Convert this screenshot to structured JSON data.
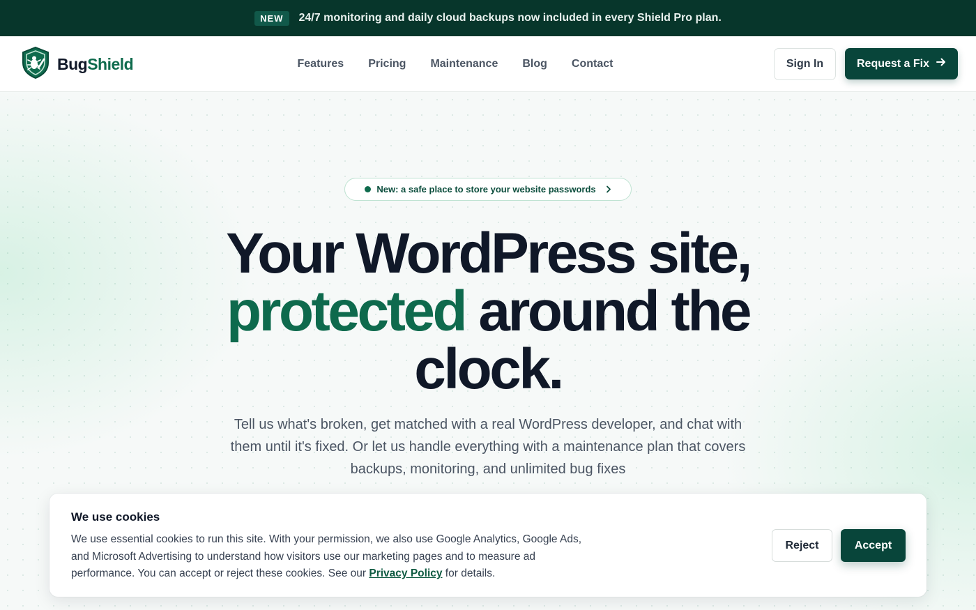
{
  "announcement": {
    "badge": "NEW",
    "message": "24/7 monitoring and daily cloud backups now included in every Shield Pro plan."
  },
  "brand": {
    "name_part1": "Bug",
    "name_part2": "Shield",
    "icon": "shield-bug-icon",
    "colors": {
      "primary": "#08453a",
      "accent": "#0f6b4d",
      "announce_bg": "#07362b"
    }
  },
  "nav": {
    "items": [
      "Features",
      "Pricing",
      "Maintenance",
      "Blog",
      "Contact"
    ]
  },
  "header_actions": {
    "sign_in": "Sign In",
    "cta": "Request a Fix",
    "cta_icon": "arrow-right-icon"
  },
  "hero": {
    "badge": "New: a safe place to store your website passwords",
    "badge_icon": "chevron-right-icon",
    "headline_line1": "Your WordPress site,",
    "headline_green": "protected",
    "headline_rest": " around the",
    "headline_line3": "clock.",
    "subtext": "Tell us what's broken, get matched with a real WordPress developer, and chat with them until it's fixed. Or let us handle everything with a maintenance plan that covers backups, monitoring, and unlimited bug fixes"
  },
  "cookie": {
    "title": "We use cookies",
    "body_before": "We use essential cookies to run this site. With your permission, we also use Google Analytics, Google Ads, and Microsoft Advertising to understand how visitors use our marketing pages and to measure ad performance. You can accept or reject these cookies. See our ",
    "link": "Privacy Policy",
    "body_after": " for details.",
    "reject": "Reject",
    "accept": "Accept"
  }
}
